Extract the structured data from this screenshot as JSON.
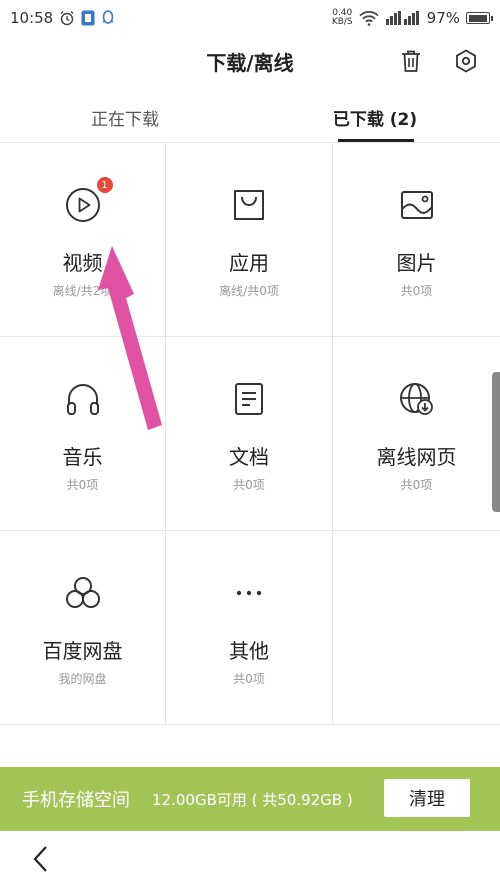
{
  "status_bar": {
    "time": "10:58",
    "net_speed_value": "0.40",
    "net_speed_unit": "KB/S",
    "battery": "97%",
    "battery_level": 0.97
  },
  "header": {
    "title": "下载/离线"
  },
  "tabs": [
    {
      "label": "正在下载"
    },
    {
      "label": "已下载 (2)"
    }
  ],
  "grid": [
    {
      "label": "视频",
      "sub": "离线/共2项",
      "badge": "1",
      "icon": "play-circle-icon"
    },
    {
      "label": "应用",
      "sub": "离线/共0项",
      "icon": "bag-icon"
    },
    {
      "label": "图片",
      "sub": "共0项",
      "icon": "image-icon"
    },
    {
      "label": "音乐",
      "sub": "共0项",
      "icon": "headphones-icon"
    },
    {
      "label": "文档",
      "sub": "共0项",
      "icon": "document-icon"
    },
    {
      "label": "离线网页",
      "sub": "共0项",
      "icon": "globe-download-icon"
    },
    {
      "label": "百度网盘",
      "sub": "我的网盘",
      "icon": "cloud-icon"
    },
    {
      "label": "其他",
      "sub": "共0项",
      "icon": "more-dots-icon"
    }
  ],
  "storage": {
    "label": "手机存储空间",
    "info": "12.00GB可用 ( 共50.92GB )",
    "clean_label": "清理"
  },
  "colors": {
    "accent_green": "#a3c558",
    "badge_red": "#e8483a",
    "annotation_pink": "#e0439a"
  }
}
